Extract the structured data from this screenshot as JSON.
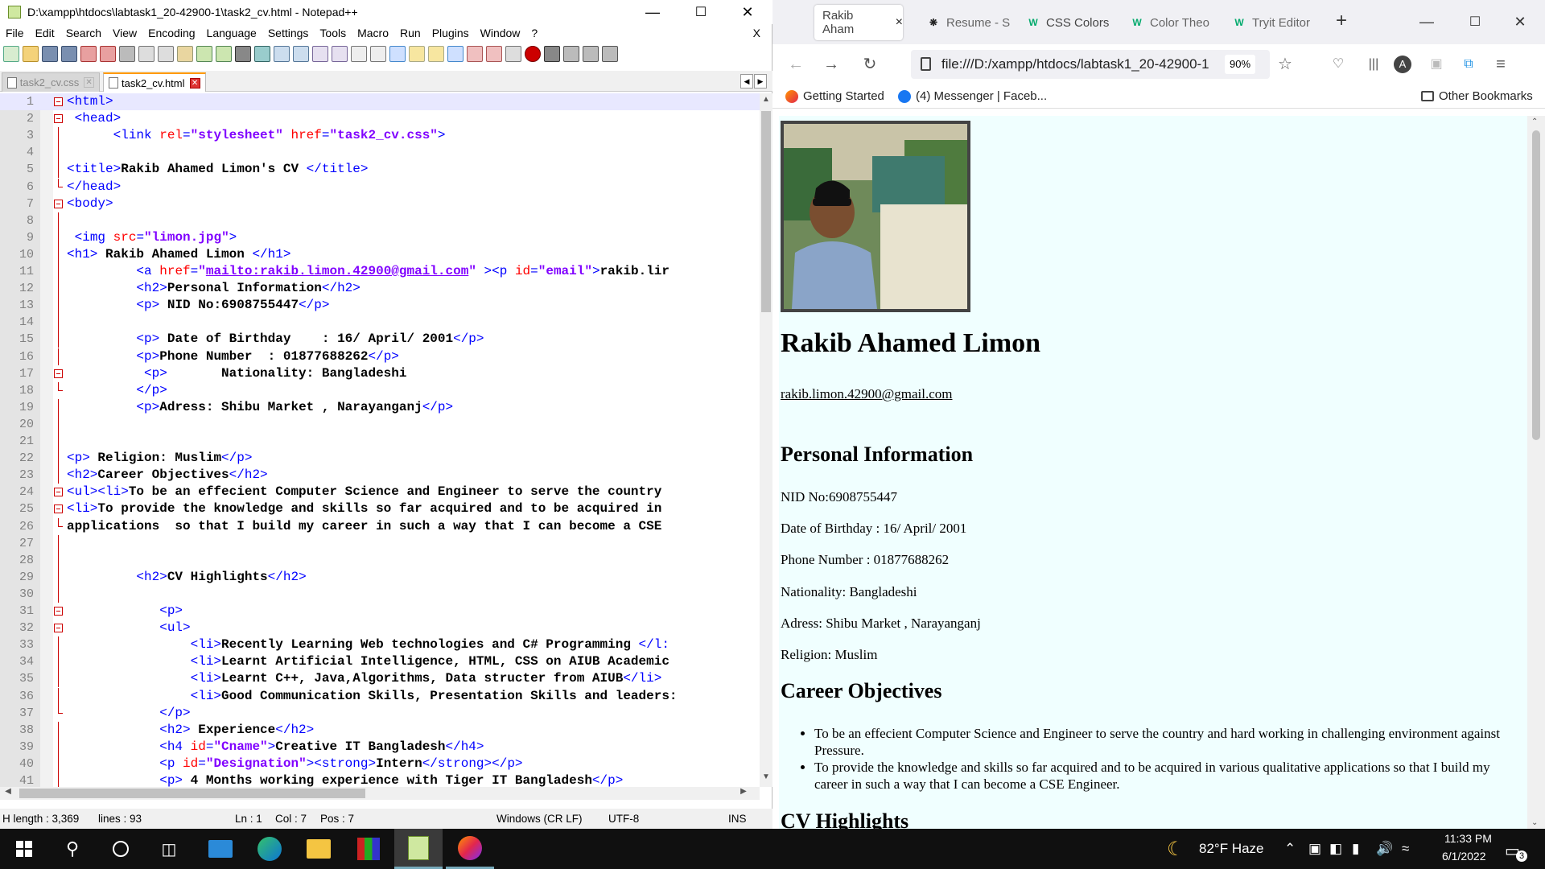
{
  "notepad": {
    "title": "D:\\xampp\\htdocs\\labtask1_20-42900-1\\task2_cv.html - Notepad++",
    "menu": [
      "File",
      "Edit",
      "Search",
      "View",
      "Encoding",
      "Language",
      "Settings",
      "Tools",
      "Macro",
      "Run",
      "Plugins",
      "Window",
      "?"
    ],
    "menu_close": "X",
    "tabs": [
      {
        "label": "task2_cv.css",
        "active": false
      },
      {
        "label": "task2_cv.html",
        "active": true
      }
    ],
    "lines": [
      {
        "n": "1",
        "parts": [
          [
            "tg",
            "<html>"
          ]
        ]
      },
      {
        "n": "2",
        "parts": [
          [
            "tx",
            " "
          ],
          [
            "tg",
            "<head>"
          ]
        ]
      },
      {
        "n": "3",
        "parts": [
          [
            "tx",
            "      "
          ],
          [
            "tg",
            "<link "
          ],
          [
            "at",
            "rel"
          ],
          [
            "tg",
            "="
          ],
          [
            "vl",
            "\"stylesheet\""
          ],
          [
            "tg",
            " "
          ],
          [
            "at",
            "href"
          ],
          [
            "tg",
            "="
          ],
          [
            "vl",
            "\"task2_cv.css\""
          ],
          [
            "tg",
            ">"
          ]
        ]
      },
      {
        "n": "4",
        "parts": []
      },
      {
        "n": "5",
        "parts": [
          [
            "tg",
            "<title>"
          ],
          [
            "tx",
            "Rakib Ahamed Limon's CV "
          ],
          [
            "tg",
            "</title>"
          ]
        ]
      },
      {
        "n": "6",
        "parts": [
          [
            "tg",
            "</head>"
          ]
        ]
      },
      {
        "n": "7",
        "parts": [
          [
            "tg",
            "<body>"
          ]
        ]
      },
      {
        "n": "8",
        "parts": []
      },
      {
        "n": "9",
        "parts": [
          [
            "tx",
            " "
          ],
          [
            "tg",
            "<img "
          ],
          [
            "at",
            "src"
          ],
          [
            "tg",
            "="
          ],
          [
            "vl",
            "\"limon.jpg\""
          ],
          [
            "tg",
            ">"
          ]
        ]
      },
      {
        "n": "10",
        "parts": [
          [
            "tg",
            "<h1>"
          ],
          [
            "tx",
            " Rakib Ahamed Limon "
          ],
          [
            "tg",
            "</h1>"
          ]
        ]
      },
      {
        "n": "11",
        "parts": [
          [
            "tx",
            "         "
          ],
          [
            "tg",
            "<a "
          ],
          [
            "at",
            "href"
          ],
          [
            "tg",
            "="
          ],
          [
            "vl",
            "\""
          ],
          [
            "lk",
            "mailto:rakib.limon.42900@gmail.com"
          ],
          [
            "vl",
            "\""
          ],
          [
            "tg",
            " ><p "
          ],
          [
            "at",
            "id"
          ],
          [
            "tg",
            "="
          ],
          [
            "vl",
            "\"email\""
          ],
          [
            "tg",
            ">"
          ],
          [
            "tx",
            "rakib.lir"
          ]
        ]
      },
      {
        "n": "12",
        "parts": [
          [
            "tx",
            "         "
          ],
          [
            "tg",
            "<h2>"
          ],
          [
            "tx",
            "Personal Information"
          ],
          [
            "tg",
            "</h2>"
          ]
        ]
      },
      {
        "n": "13",
        "parts": [
          [
            "tx",
            "         "
          ],
          [
            "tg",
            "<p>"
          ],
          [
            "tx",
            " NID No:6908755447"
          ],
          [
            "tg",
            "</p>"
          ]
        ]
      },
      {
        "n": "14",
        "parts": []
      },
      {
        "n": "15",
        "parts": [
          [
            "tx",
            "         "
          ],
          [
            "tg",
            "<p>"
          ],
          [
            "tx",
            " Date of Birthday    : 16/ April/ 2001"
          ],
          [
            "tg",
            "</p>"
          ]
        ]
      },
      {
        "n": "16",
        "parts": [
          [
            "tx",
            "         "
          ],
          [
            "tg",
            "<p>"
          ],
          [
            "tx",
            "Phone Number  : 01877688262"
          ],
          [
            "tg",
            "</p>"
          ]
        ]
      },
      {
        "n": "17",
        "parts": [
          [
            "tx",
            "          "
          ],
          [
            "tg",
            "<p>"
          ],
          [
            "tx",
            "       Nationality: Bangladeshi"
          ]
        ]
      },
      {
        "n": "18",
        "parts": [
          [
            "tx",
            "         "
          ],
          [
            "tg",
            "</p>"
          ]
        ]
      },
      {
        "n": "19",
        "parts": [
          [
            "tx",
            "         "
          ],
          [
            "tg",
            "<p>"
          ],
          [
            "tx",
            "Adress: Shibu Market , Narayanganj"
          ],
          [
            "tg",
            "</p>"
          ]
        ]
      },
      {
        "n": "20",
        "parts": []
      },
      {
        "n": "21",
        "parts": []
      },
      {
        "n": "22",
        "parts": [
          [
            "tg",
            "<p>"
          ],
          [
            "tx",
            " Religion: Muslim"
          ],
          [
            "tg",
            "</p>"
          ]
        ]
      },
      {
        "n": "23",
        "parts": [
          [
            "tg",
            "<h2>"
          ],
          [
            "tx",
            "Career Objectives"
          ],
          [
            "tg",
            "</h2>"
          ]
        ]
      },
      {
        "n": "24",
        "parts": [
          [
            "tg",
            "<ul><li>"
          ],
          [
            "tx",
            "To be an effecient Computer Science and Engineer to serve the country"
          ]
        ]
      },
      {
        "n": "25",
        "parts": [
          [
            "tg",
            "<li>"
          ],
          [
            "tx",
            "To provide the knowledge and skills so far acquired and to be acquired in"
          ]
        ]
      },
      {
        "n": "26",
        "parts": [
          [
            "tx",
            "applications  so that I build my career in such a way that I can become a CSE"
          ]
        ]
      },
      {
        "n": "27",
        "parts": []
      },
      {
        "n": "28",
        "parts": []
      },
      {
        "n": "29",
        "parts": [
          [
            "tx",
            "         "
          ],
          [
            "tg",
            "<h2>"
          ],
          [
            "tx",
            "CV Highlights"
          ],
          [
            "tg",
            "</h2>"
          ]
        ]
      },
      {
        "n": "30",
        "parts": []
      },
      {
        "n": "31",
        "parts": [
          [
            "tx",
            "            "
          ],
          [
            "tg",
            "<p>"
          ]
        ]
      },
      {
        "n": "32",
        "parts": [
          [
            "tx",
            "            "
          ],
          [
            "tg",
            "<ul>"
          ]
        ]
      },
      {
        "n": "33",
        "parts": [
          [
            "tx",
            "                "
          ],
          [
            "tg",
            "<li>"
          ],
          [
            "tx",
            "Recently Learning Web technologies and C# Programming "
          ],
          [
            "tg",
            "</l:"
          ]
        ]
      },
      {
        "n": "34",
        "parts": [
          [
            "tx",
            "                "
          ],
          [
            "tg",
            "<li>"
          ],
          [
            "tx",
            "Learnt Artificial Intelligence, HTML, CSS on AIUB Academic"
          ]
        ]
      },
      {
        "n": "35",
        "parts": [
          [
            "tx",
            "                "
          ],
          [
            "tg",
            "<li>"
          ],
          [
            "tx",
            "Learnt C++, Java,Algorithms, Data structer from AIUB"
          ],
          [
            "tg",
            "</li>"
          ]
        ]
      },
      {
        "n": "36",
        "parts": [
          [
            "tx",
            "                "
          ],
          [
            "tg",
            "<li>"
          ],
          [
            "tx",
            "Good Communication Skills, Presentation Skills and leaders:"
          ]
        ]
      },
      {
        "n": "37",
        "parts": [
          [
            "tx",
            "            "
          ],
          [
            "tg",
            "</p>"
          ]
        ]
      },
      {
        "n": "38",
        "parts": [
          [
            "tx",
            "            "
          ],
          [
            "tg",
            "<h2>"
          ],
          [
            "tx",
            " Experience"
          ],
          [
            "tg",
            "</h2>"
          ]
        ]
      },
      {
        "n": "39",
        "parts": [
          [
            "tx",
            "            "
          ],
          [
            "tg",
            "<h4 "
          ],
          [
            "at",
            "id"
          ],
          [
            "tg",
            "="
          ],
          [
            "vl",
            "\"Cname\""
          ],
          [
            "tg",
            ">"
          ],
          [
            "tx",
            "Creative IT Bangladesh"
          ],
          [
            "tg",
            "</h4>"
          ]
        ]
      },
      {
        "n": "40",
        "parts": [
          [
            "tx",
            "            "
          ],
          [
            "tg",
            "<p "
          ],
          [
            "at",
            "id"
          ],
          [
            "tg",
            "="
          ],
          [
            "vl",
            "\"Designation\""
          ],
          [
            "tg",
            "><strong>"
          ],
          [
            "tx",
            "Intern"
          ],
          [
            "tg",
            "</strong></p>"
          ]
        ]
      },
      {
        "n": "41",
        "parts": [
          [
            "tx",
            "            "
          ],
          [
            "tg",
            "<p>"
          ],
          [
            "tx",
            " 4 Months working experience with Tiger IT Bangladesh"
          ],
          [
            "tg",
            "</p>"
          ]
        ]
      }
    ],
    "status": {
      "length": "H length : 3,369",
      "lines": "lines : 93",
      "ln": "Ln : 1",
      "col": "Col : 7",
      "pos": "Pos : 7",
      "eol": "Windows (CR LF)",
      "enc": "UTF-8",
      "mode": "INS"
    }
  },
  "browser": {
    "tabs": [
      {
        "label": "Rakib Aham",
        "icon": "page-icon",
        "close": "×"
      },
      {
        "label": "Resume - S",
        "icon": "openai-icon"
      },
      {
        "label": "CSS Colors",
        "icon": "w3-icon"
      },
      {
        "label": "Color Theo",
        "icon": "w3-icon"
      },
      {
        "label": "Tryit Editor",
        "icon": "w3-icon"
      }
    ],
    "new_tab": "+",
    "url": "file:///D:/xampp/htdocs/labtask1_20-42900-1",
    "zoom": "90%",
    "bookmarks": [
      "Getting Started",
      "(4) Messenger | Faceb..."
    ],
    "other_bookmarks": "Other Bookmarks",
    "page": {
      "name": "Rakib Ahamed Limon",
      "email": "rakib.limon.42900@gmail.com",
      "h_personal": "Personal Information",
      "nid": "NID No:6908755447",
      "dob": "Date of Birthday : 16/ April/ 2001",
      "phone": "Phone Number : 01877688262",
      "nationality": "Nationality: Bangladeshi",
      "address": "Adress: Shibu Market , Narayanganj",
      "religion": "Religion: Muslim",
      "h_career": "Career Objectives",
      "objectives": [
        "To be an effecient Computer Science and Engineer to serve the country and hard working in challenging environment against Pressure.",
        "To provide the knowledge and skills so far acquired and to be acquired in various qualitative applications so that I build my career in such a way that I can become a CSE Engineer."
      ],
      "h_cv": "CV Highlights"
    }
  },
  "taskbar": {
    "weather": "82°F  Haze",
    "time": "11:33 PM",
    "date": "6/1/2022",
    "notif_count": "3"
  }
}
